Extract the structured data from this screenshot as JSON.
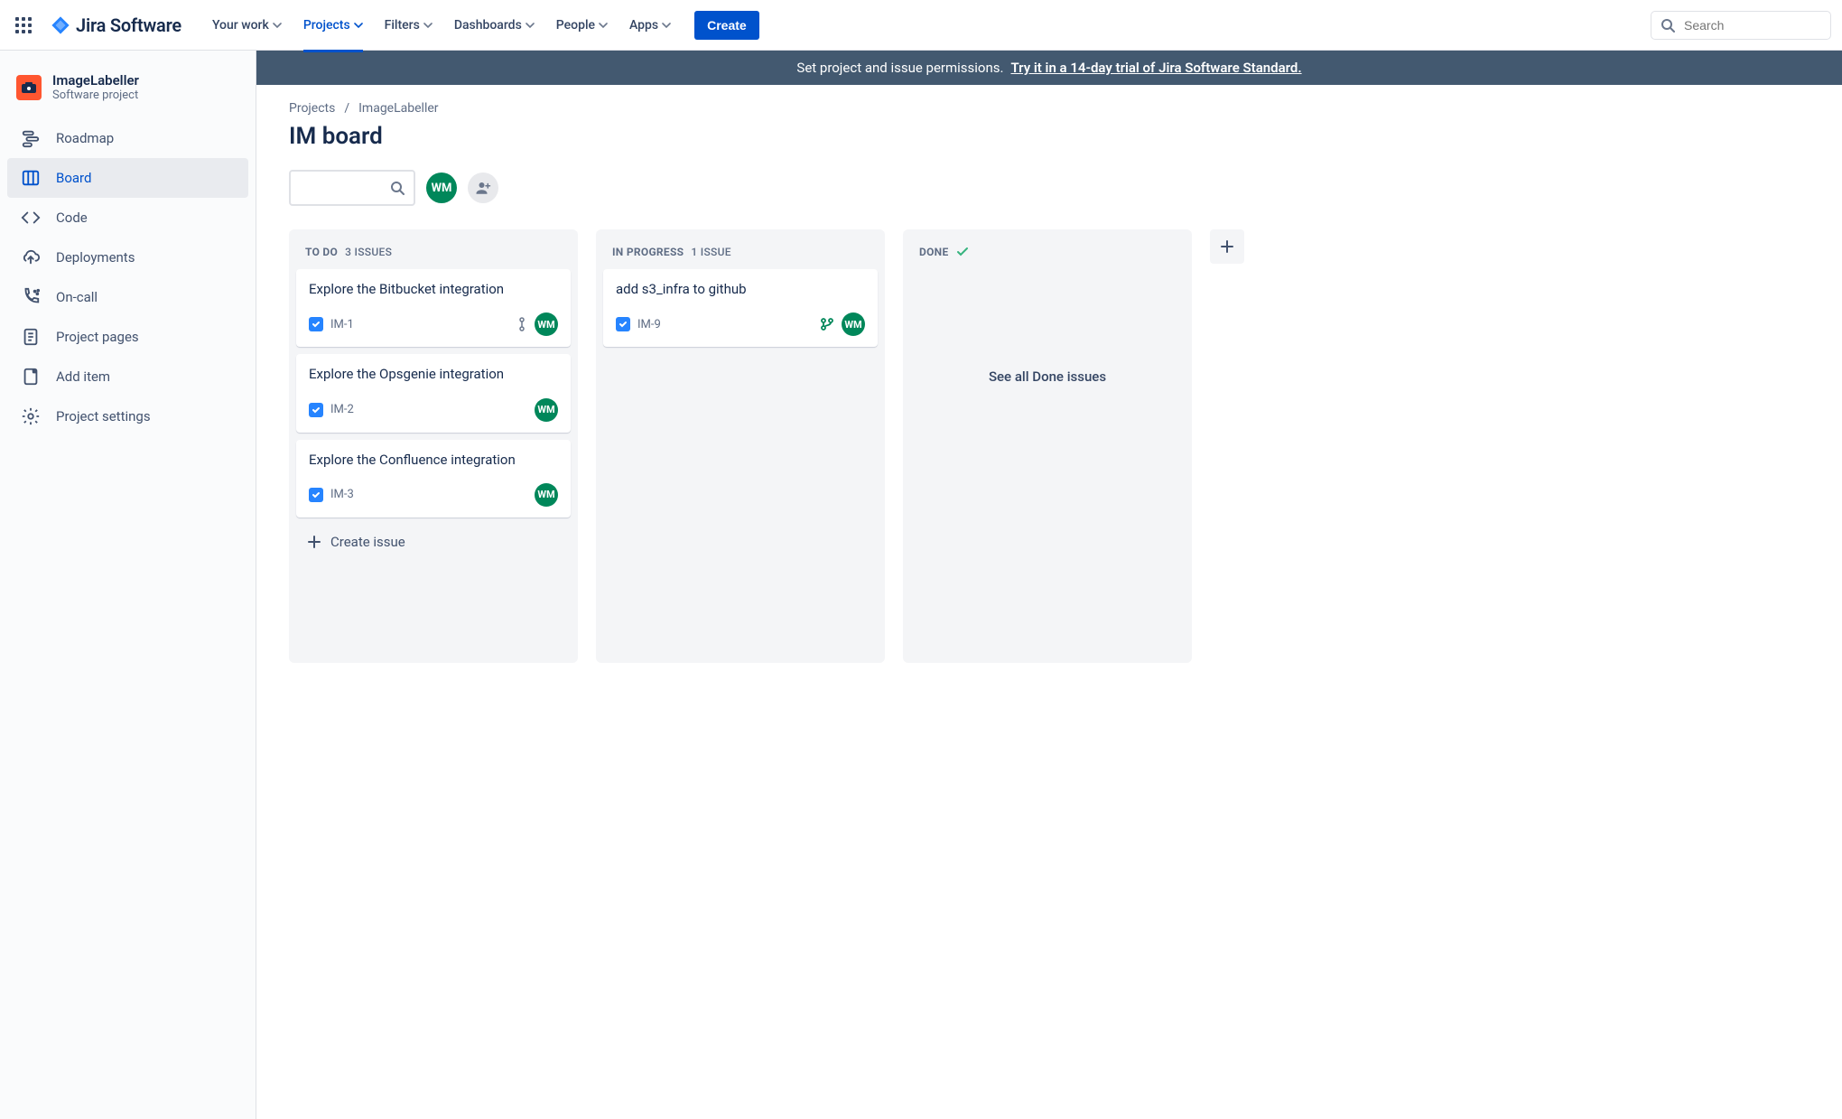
{
  "brand": {
    "name": "Jira Software"
  },
  "nav": {
    "items": [
      {
        "label": "Your work"
      },
      {
        "label": "Projects"
      },
      {
        "label": "Filters"
      },
      {
        "label": "Dashboards"
      },
      {
        "label": "People"
      },
      {
        "label": "Apps"
      }
    ],
    "active_index": 1,
    "create_label": "Create",
    "search_placeholder": "Search"
  },
  "banner": {
    "text": "Set project and issue permissions.",
    "link_text": "Try it in a 14-day trial of Jira Software Standard."
  },
  "project": {
    "name": "ImageLabeller",
    "type": "Software project"
  },
  "sidebar": {
    "items": [
      {
        "label": "Roadmap"
      },
      {
        "label": "Board"
      },
      {
        "label": "Code"
      },
      {
        "label": "Deployments"
      },
      {
        "label": "On-call"
      },
      {
        "label": "Project pages"
      },
      {
        "label": "Add item"
      },
      {
        "label": "Project settings"
      }
    ],
    "active_index": 1
  },
  "breadcrumb": {
    "root": "Projects",
    "current": "ImageLabeller"
  },
  "board": {
    "title": "IM board",
    "user_initials": "WM",
    "columns": [
      {
        "name": "TO DO",
        "count_label": "3 ISSUES"
      },
      {
        "name": "IN PROGRESS",
        "count_label": "1 ISSUE"
      },
      {
        "name": "DONE",
        "count_label": ""
      }
    ],
    "create_issue_label": "Create issue",
    "done_link_label": "See all Done issues",
    "cards": {
      "todo": [
        {
          "title": "Explore the Bitbucket integration",
          "key": "IM-1",
          "assignee": "WM",
          "priority": true
        },
        {
          "title": "Explore the Opsgenie integration",
          "key": "IM-2",
          "assignee": "WM",
          "priority": false
        },
        {
          "title": "Explore the Confluence integration",
          "key": "IM-3",
          "assignee": "WM",
          "priority": false
        }
      ],
      "inprogress": [
        {
          "title": "add s3_infra to github",
          "key": "IM-9",
          "assignee": "WM",
          "branch": true
        }
      ]
    }
  }
}
